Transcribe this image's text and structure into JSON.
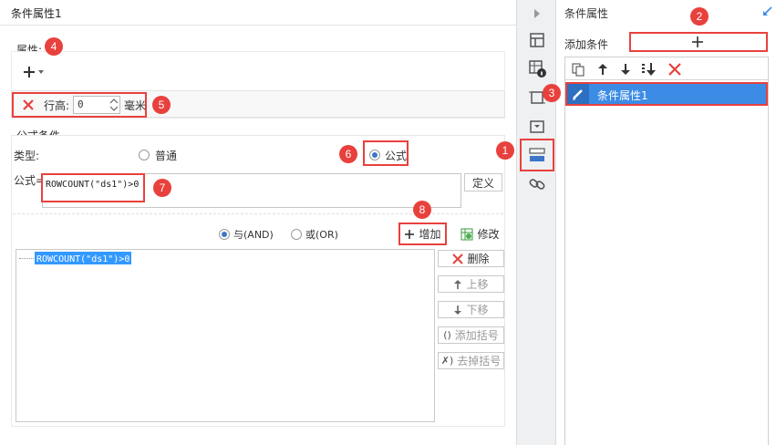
{
  "dialog": {
    "title": "条件属性1",
    "property_label": "属性:",
    "row_height_label": "行高:",
    "row_height_value": "0",
    "unit_label": "毫米",
    "formula_group_label": "公式条件",
    "type_label": "类型:",
    "type_normal": "普通",
    "type_formula": "公式",
    "formula_label": "公式=",
    "formula_value": "ROWCOUNT(\"ds1\")>0",
    "define_button": "定义",
    "and_label": "与(AND)",
    "or_label": "或(OR)",
    "add_button": "增加",
    "modify_button": "修改",
    "condition_item": "ROWCOUNT(\"ds1\")>0",
    "delete_button": "删除",
    "up_button": "上移",
    "down_button": "下移",
    "add_bracket_button": "添加括号",
    "remove_bracket_button": "去掉括号"
  },
  "right_panel": {
    "title": "条件属性",
    "add_condition_label": "添加条件",
    "list_items": [
      "条件属性1"
    ]
  },
  "badges": [
    "1",
    "2",
    "3",
    "4",
    "5",
    "6",
    "7",
    "8"
  ],
  "colors": {
    "annotation_red": "#e8413d",
    "selection_blue": "#3c8be5",
    "highlight_blue": "#3399ff",
    "toolbar_bg": "#eef0f2",
    "accent_blue": "#3c76c9"
  }
}
